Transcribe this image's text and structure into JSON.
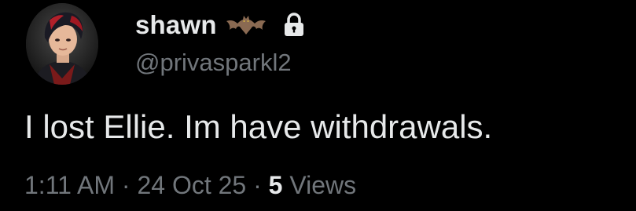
{
  "author": {
    "display_name": "shawn",
    "handle": "@privasparkl2",
    "name_emoji": "bat-icon",
    "protected_icon": "lock-icon",
    "avatar": "avatar"
  },
  "tweet": {
    "text": "I lost Ellie. Im have withdrawals."
  },
  "meta": {
    "time": "1:11 AM",
    "separator_1": "·",
    "date": "24 Oct 25",
    "separator_2": "·",
    "views_count": "5",
    "views_label": "Views"
  },
  "colors": {
    "background": "#000000",
    "primary_text": "#e7e9ea",
    "secondary_text": "#71767b"
  }
}
